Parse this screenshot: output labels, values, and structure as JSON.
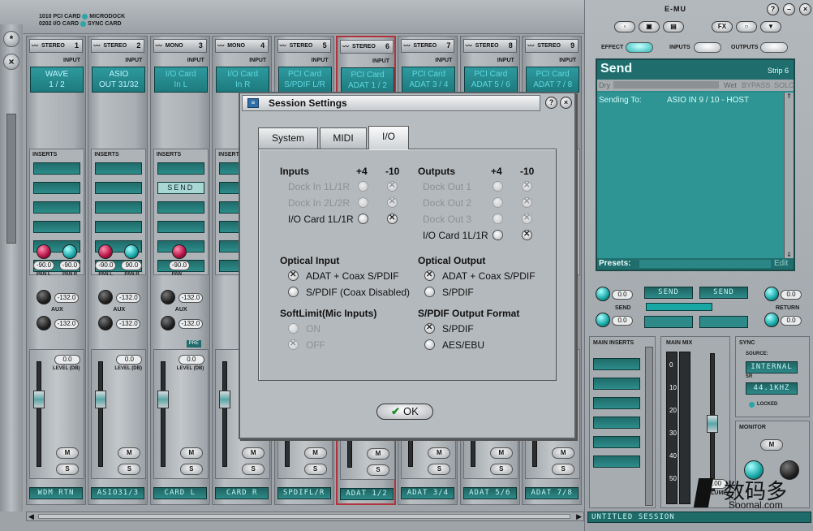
{
  "hardware": {
    "card1": "1010 PCI CARD",
    "dock": "MICRODOCK",
    "card2": "0202 I/O CARD",
    "sync": "SYNC CARD"
  },
  "rail": {
    "btn1": "*",
    "btn2": "×"
  },
  "strips": [
    {
      "type": "STEREO",
      "num": "1",
      "input_l1": "WAVE",
      "input_l2": "1 / 2",
      "insert_text": "",
      "knob_vals": [
        "-90.0",
        "-90.0"
      ],
      "knob_labels": [
        "PAN L",
        "PAN R"
      ],
      "aux": [
        "-132.0",
        "-132.0"
      ],
      "level": "0.0",
      "bottom": "WDM RTN",
      "sel": false
    },
    {
      "type": "STEREO",
      "num": "2",
      "input_l1": "ASIO",
      "input_l2": "OUT 31/32",
      "insert_text": "",
      "knob_vals": [
        "-90.0",
        "90.0"
      ],
      "knob_labels": [
        "PAN L",
        "PAN R"
      ],
      "aux": [
        "-132.0",
        "-132.0"
      ],
      "level": "0.0",
      "bottom": "ASIO31/3",
      "sel": false
    },
    {
      "type": "MONO",
      "num": "3",
      "input_l1": "I/O Card",
      "input_l2": "In L",
      "insert_text": "SEND",
      "knob_vals": [
        "-90.0"
      ],
      "knob_labels": [
        "PAN"
      ],
      "aux": [
        "-132.0",
        "-132.0"
      ],
      "level": "0.0",
      "bottom": "CARD L",
      "sel": false
    },
    {
      "type": "MONO",
      "num": "4",
      "input_l1": "I/O Card",
      "input_l2": "In R",
      "insert_text": "",
      "knob_vals": [],
      "knob_labels": [],
      "aux": [],
      "level": "",
      "bottom": "CARD R",
      "sel": false
    },
    {
      "type": "STEREO",
      "num": "5",
      "input_l1": "PCI Card",
      "input_l2": "S/PDIF L/R",
      "insert_text": "",
      "knob_vals": [],
      "knob_labels": [],
      "aux": [],
      "level": "",
      "bottom": "SPDIFL/R",
      "sel": false
    },
    {
      "type": "STEREO",
      "num": "6",
      "input_l1": "PCI Card",
      "input_l2": "ADAT 1 / 2",
      "insert_text": "",
      "knob_vals": [],
      "knob_labels": [],
      "aux": [],
      "level": "",
      "bottom": "ADAT 1/2",
      "sel": true
    },
    {
      "type": "STEREO",
      "num": "7",
      "input_l1": "PCI Card",
      "input_l2": "ADAT 3 / 4",
      "insert_text": "",
      "knob_vals": [],
      "knob_labels": [],
      "aux": [],
      "level": "",
      "bottom": "ADAT 3/4",
      "sel": false
    },
    {
      "type": "STEREO",
      "num": "8",
      "input_l1": "PCI Card",
      "input_l2": "ADAT 5 / 6",
      "insert_text": "",
      "knob_vals": [],
      "knob_labels": [],
      "aux": [],
      "level": "",
      "bottom": "ADAT 5/6",
      "sel": false
    },
    {
      "type": "STEREO",
      "num": "9",
      "input_l1": "PCI Card",
      "input_l2": "ADAT 7 / 8",
      "insert_text": "",
      "knob_vals": [],
      "knob_labels": [],
      "aux": [],
      "level": "",
      "bottom": "ADAT 7/8",
      "sel": false
    }
  ],
  "labels": {
    "input": "INPUT",
    "inserts": "INSERTS",
    "aux": "AUX",
    "level": "LEVEL (DB)",
    "mute": "M",
    "solo": "S",
    "pre": "PRE"
  },
  "right": {
    "brand": "E-MU",
    "top_buttons": [
      "▫",
      "▣",
      "▤",
      "FX",
      "○",
      "▼"
    ],
    "effect": "EFFECT",
    "inputs": "INPUTS",
    "outputs": "OUTPUTS",
    "send_title": "Send",
    "strip_label": "Strip 6",
    "dry": "Dry",
    "wet": "Wet",
    "bypass": "BYPASS",
    "solo": "SOLO",
    "sending_to_label": "Sending To:",
    "sending_to_value": "ASIO IN 9 / 10 - HOST",
    "presets": "Presets:",
    "edit": "Edit",
    "send_lcd1": "SEND",
    "send_lcd2": "SEND",
    "send_label": "SEND",
    "return_label": "RETURN",
    "send_vals": [
      "0.0",
      "0.0"
    ],
    "return_vals": [
      "0.0",
      "0.0"
    ],
    "main_inserts": "MAIN INSERTS",
    "main_mix": "MAIN MIX",
    "sync": "SYNC",
    "source_label": "SOURCE:",
    "source_value": "INTERNAL",
    "sr_label": "SR",
    "sr_value": "44.1KHZ",
    "locked": "LOCKED",
    "monitor": "MONITOR",
    "volume": "VOLUME",
    "volume_val": "-6.00",
    "scale": [
      "0",
      "10",
      "20",
      "30",
      "40",
      "50"
    ],
    "session_name": "UNTITLED SESSION"
  },
  "dialog": {
    "title": "Session Settings",
    "help": "?",
    "close": "×",
    "tabs": [
      "System",
      "MIDI",
      "I/O"
    ],
    "active_tab": "I/O",
    "inputs_title": "Inputs",
    "outputs_title": "Outputs",
    "plus4": "+4",
    "minus10": "-10",
    "inputs": [
      {
        "label": "Dock In 1L/1R",
        "enabled": false,
        "sel": "-10"
      },
      {
        "label": "Dock In 2L/2R",
        "enabled": false,
        "sel": "-10"
      },
      {
        "label": "I/O Card 1L/1R",
        "enabled": true,
        "sel": "-10"
      }
    ],
    "outputs": [
      {
        "label": "Dock Out 1",
        "enabled": false,
        "sel": "-10"
      },
      {
        "label": "Dock Out 2",
        "enabled": false,
        "sel": "-10"
      },
      {
        "label": "Dock Out 3",
        "enabled": false,
        "sel": "-10"
      },
      {
        "label": "I/O Card 1L/1R",
        "enabled": true,
        "sel": "-10"
      }
    ],
    "optical_input_title": "Optical Input",
    "optical_input": [
      {
        "label": "ADAT + Coax S/PDIF",
        "checked": true
      },
      {
        "label": "S/PDIF (Coax Disabled)",
        "checked": false
      }
    ],
    "optical_output_title": "Optical Output",
    "optical_output": [
      {
        "label": "ADAT + Coax S/PDIF",
        "checked": true
      },
      {
        "label": "S/PDIF",
        "checked": false
      }
    ],
    "softlimit_title": "SoftLimit(Mic Inputs)",
    "softlimit": [
      {
        "label": "ON",
        "checked": false
      },
      {
        "label": "OFF",
        "checked": true
      }
    ],
    "spdif_format_title": "S/PDIF Output Format",
    "spdif_format": [
      {
        "label": "S/PDIF",
        "checked": true
      },
      {
        "label": "AES/EBU",
        "checked": false
      }
    ],
    "ok": "OK"
  },
  "watermark": {
    "cn": "数码多",
    "url": "Soomal.com"
  }
}
